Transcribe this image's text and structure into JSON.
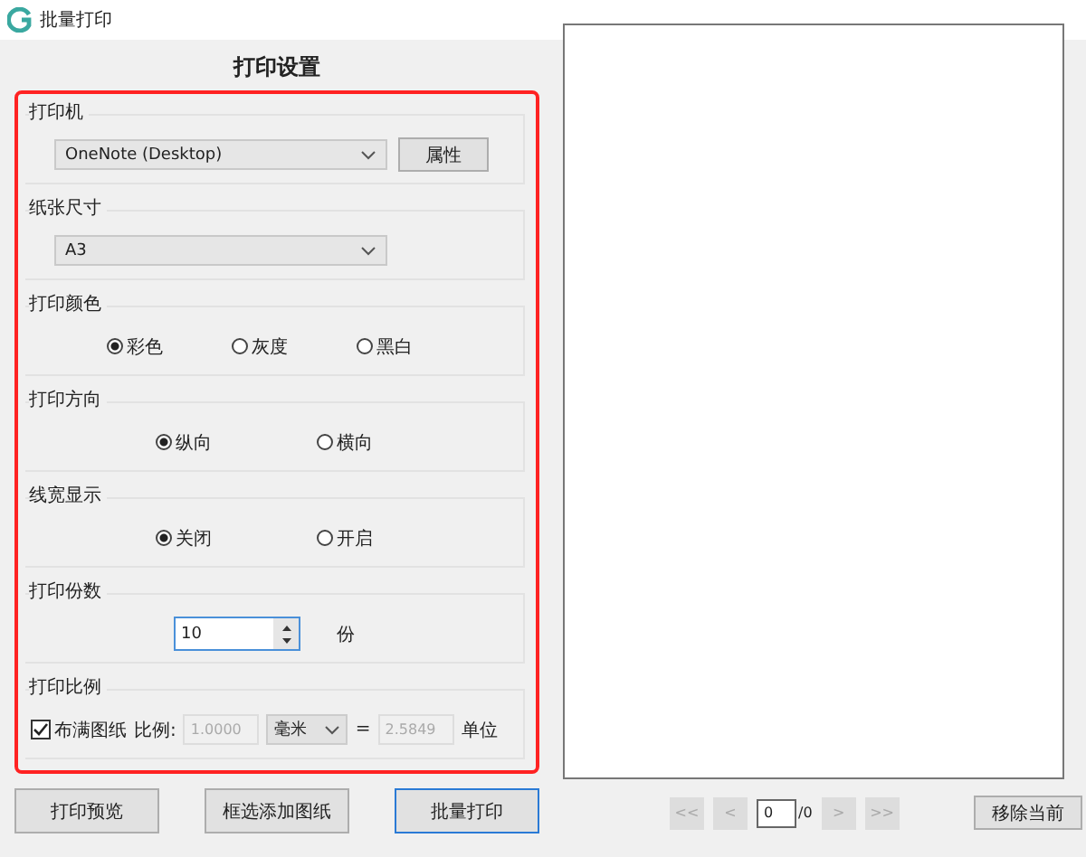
{
  "window": {
    "title": "批量打印"
  },
  "heading": "打印设置",
  "groups": [
    {
      "kind": "select",
      "label": "打印机",
      "value": "OneNote (Desktop)",
      "button": "属性"
    },
    {
      "kind": "select",
      "label": "纸张尺寸",
      "value": "A3"
    },
    {
      "kind": "radios",
      "label": "打印颜色",
      "options": [
        {
          "label": "彩色",
          "selected": true
        },
        {
          "label": "灰度",
          "selected": false
        },
        {
          "label": "黑白",
          "selected": false
        }
      ]
    },
    {
      "kind": "radios",
      "label": "打印方向",
      "options": [
        {
          "label": "纵向",
          "selected": true
        },
        {
          "label": "横向",
          "selected": false
        }
      ]
    },
    {
      "kind": "radios",
      "label": "线宽显示",
      "options": [
        {
          "label": "关闭",
          "selected": true
        },
        {
          "label": "开启",
          "selected": false
        }
      ]
    },
    {
      "kind": "spinner",
      "label": "打印份数",
      "value": "10",
      "unit": "份"
    },
    {
      "kind": "scale",
      "label": "打印比例",
      "checkbox": {
        "label": "布满图纸",
        "checked": true
      },
      "ratio_label": "比例:",
      "ratio": "1.0000",
      "unit_select": "毫米",
      "equals": "=",
      "units_value": "2.5849",
      "units_label": "单位"
    }
  ],
  "buttons": [
    {
      "label": "打印预览",
      "focused": false
    },
    {
      "label": "框选添加图纸",
      "focused": false
    },
    {
      "label": "批量打印",
      "focused": true
    }
  ],
  "pager": {
    "first": "<<",
    "prev": "<",
    "page": "0",
    "total": "/0",
    "next": ">",
    "last": ">>"
  },
  "remove_button": "移除当前"
}
